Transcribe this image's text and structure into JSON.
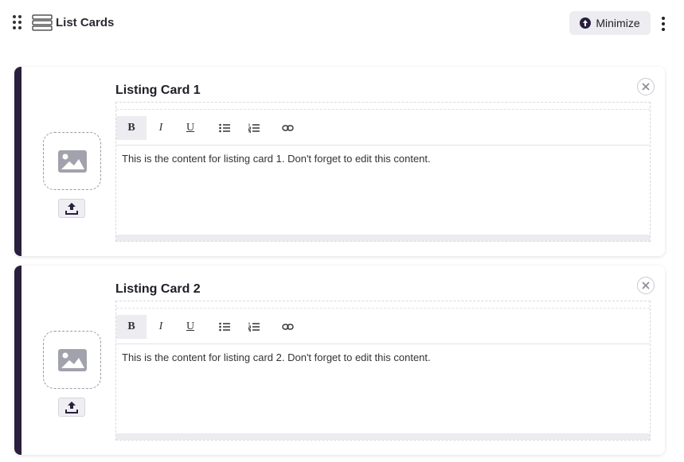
{
  "header": {
    "title": "List Cards",
    "minimize_label": "Minimize"
  },
  "cards": [
    {
      "title": "Listing Card 1",
      "content": "This is the content for listing card 1. Don't forget to edit this content."
    },
    {
      "title": "Listing Card 2",
      "content": "This is the content for listing card 2. Don't forget to edit this content."
    }
  ],
  "toolbar": {
    "bold": "B",
    "italic": "I",
    "underline": "U"
  },
  "icons": [
    "drag-handle-icon",
    "list-icon",
    "minimize-icon",
    "more-vertical-icon",
    "image-icon",
    "upload-icon",
    "close-icon",
    "bullet-list-icon",
    "numbered-list-icon",
    "link-icon"
  ],
  "colors": {
    "accent": "#2a1f3d",
    "button_bg": "#ececf1"
  }
}
